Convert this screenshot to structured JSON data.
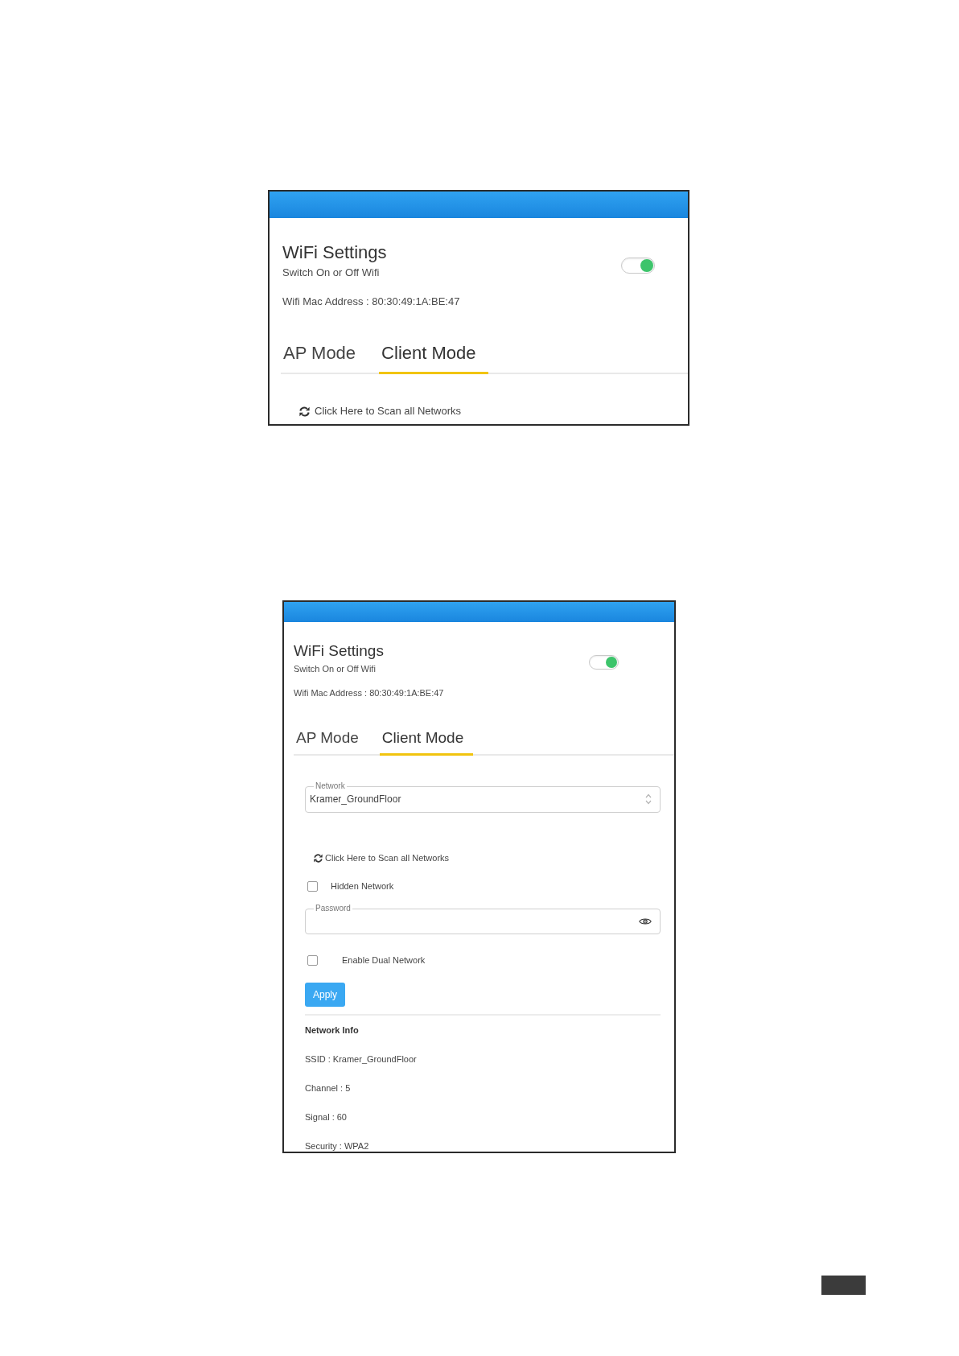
{
  "panels": [
    {
      "title": "WiFi Settings",
      "subtitle": "Switch On or Off Wifi",
      "wifi_switch": {
        "on": true
      },
      "mac_address": "Wifi Mac Address : 80:30:49:1A:BE:47",
      "tabs": [
        {
          "label": "AP Mode",
          "selected": false
        },
        {
          "label": "Client Mode",
          "selected": true
        }
      ],
      "content": [
        {
          "kind": "scan_link",
          "label": "Click Here to Scan all Networks"
        }
      ]
    },
    {
      "title": "WiFi Settings",
      "subtitle": "Switch On or Off Wifi",
      "wifi_switch": {
        "on": true
      },
      "mac_address": "Wifi Mac Address : 80:30:49:1A:BE:47",
      "tabs": [
        {
          "label": "AP Mode",
          "selected": false
        },
        {
          "label": "Client Mode",
          "selected": true
        }
      ],
      "content": [
        {
          "kind": "select",
          "label": "Network",
          "value": "Kramer_GroundFloor"
        },
        {
          "kind": "scan_link",
          "label": "Click Here to Scan all Networks"
        },
        {
          "kind": "checkbox",
          "label": "Hidden Network",
          "checked": false
        },
        {
          "kind": "password",
          "label": "Password"
        },
        {
          "kind": "checkbox",
          "label": "Enable Dual Network",
          "checked": false
        },
        {
          "kind": "button",
          "label": "Apply"
        },
        {
          "kind": "info",
          "heading": "Network Info",
          "lines": [
            "SSID : Kramer_GroundFloor",
            "Channel : 5",
            "Signal : 60",
            "Security : WPA2"
          ]
        }
      ]
    }
  ]
}
